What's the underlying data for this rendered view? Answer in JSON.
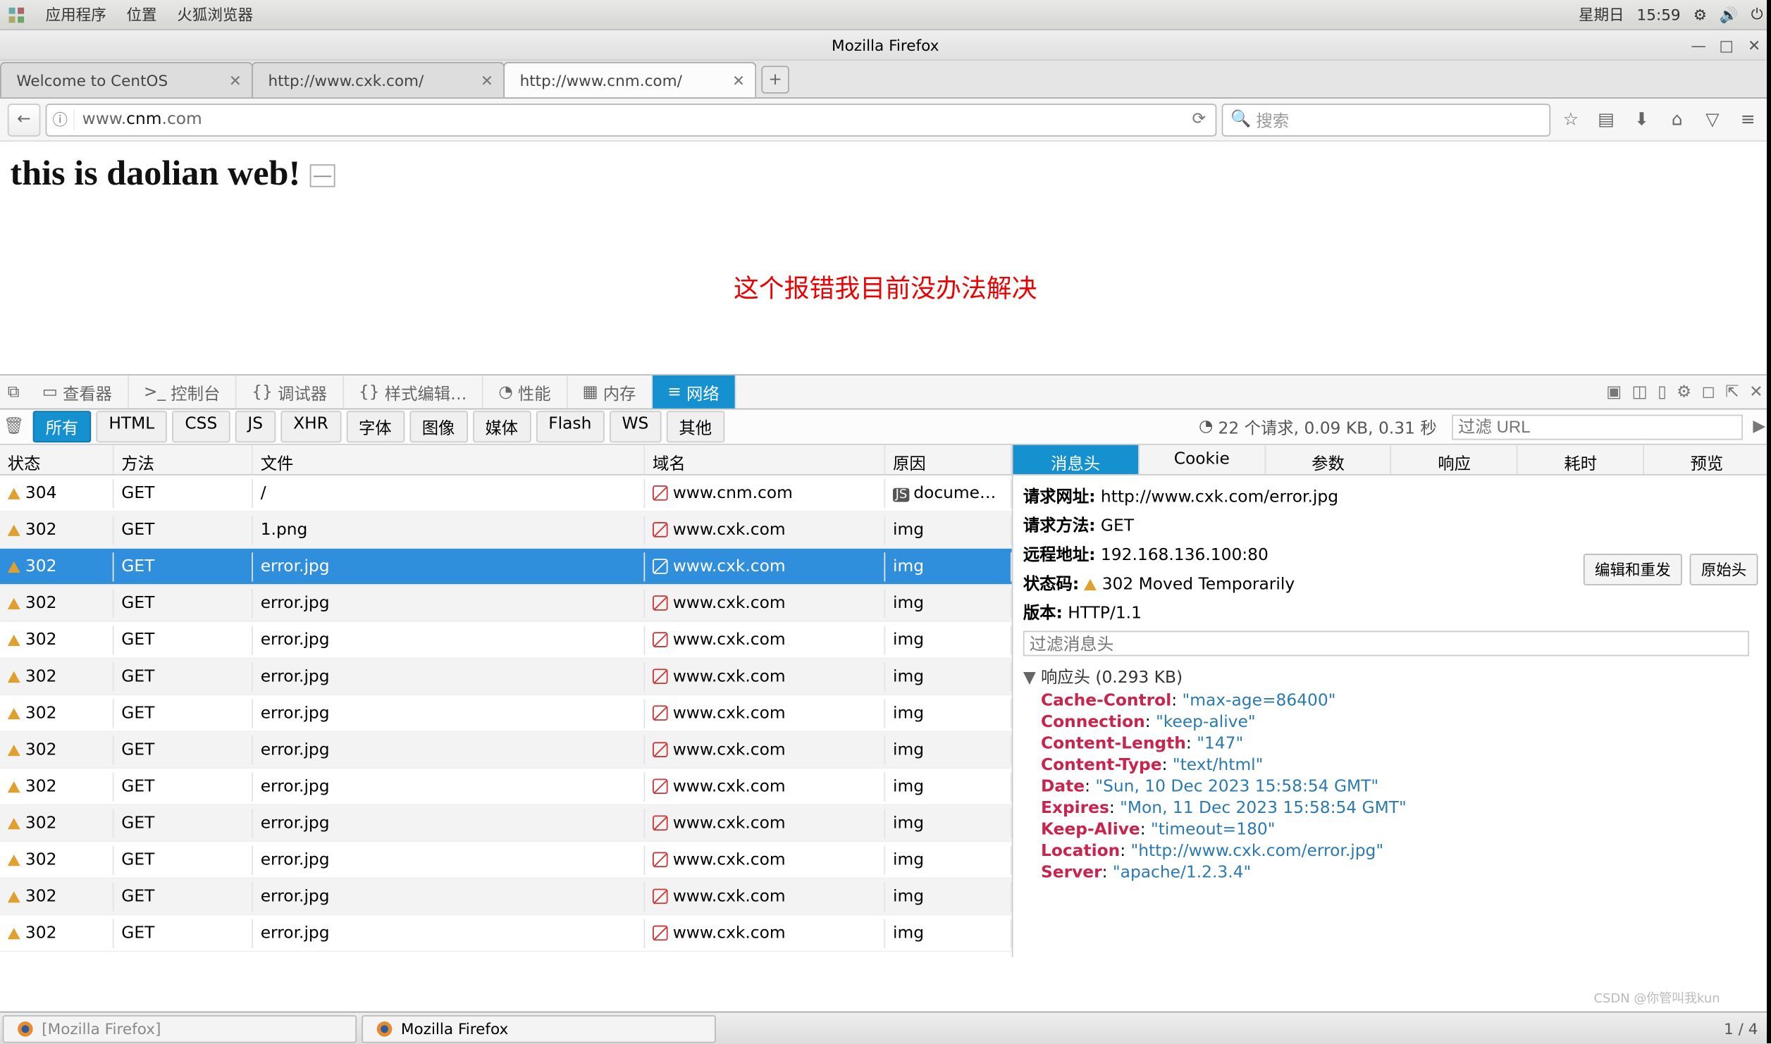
{
  "topbar": {
    "menus": [
      "应用程序",
      "位置",
      "火狐浏览器"
    ],
    "day": "星期日",
    "time": "15:59"
  },
  "window": {
    "title": "Mozilla Firefox"
  },
  "tabs": [
    {
      "label": "Welcome to CentOS",
      "active": false
    },
    {
      "label": "http://www.cxk.com/",
      "active": false
    },
    {
      "label": "http://www.cnm.com/",
      "active": true
    }
  ],
  "url": {
    "prefix": "www.",
    "host": "cnm",
    "suffix": ".com",
    "search_placeholder": "搜索"
  },
  "page": {
    "heading": "this is daolian web!",
    "red_note": "这个报错我目前没办法解决"
  },
  "devtools": {
    "panel_tabs": [
      "查看器",
      "控制台",
      "调试器",
      "样式编辑…",
      "性能",
      "内存",
      "网络"
    ],
    "active_panel": 6,
    "net_filters": [
      "所有",
      "HTML",
      "CSS",
      "JS",
      "XHR",
      "字体",
      "图像",
      "媒体",
      "Flash",
      "WS",
      "其他"
    ],
    "net_active_filter": 0,
    "summary": "22 个请求, 0.09 KB, 0.31 秒",
    "filter_url_placeholder": "过滤 URL",
    "columns": [
      "状态",
      "方法",
      "文件",
      "域名",
      "原因"
    ],
    "rows": [
      {
        "status": "304",
        "method": "GET",
        "file": "/",
        "domain": "www.cnm.com",
        "reason": "document",
        "sel": false
      },
      {
        "status": "302",
        "method": "GET",
        "file": "1.png",
        "domain": "www.cxk.com",
        "reason": "img",
        "sel": false
      },
      {
        "status": "302",
        "method": "GET",
        "file": "error.jpg",
        "domain": "www.cxk.com",
        "reason": "img",
        "sel": true
      },
      {
        "status": "302",
        "method": "GET",
        "file": "error.jpg",
        "domain": "www.cxk.com",
        "reason": "img",
        "sel": false
      },
      {
        "status": "302",
        "method": "GET",
        "file": "error.jpg",
        "domain": "www.cxk.com",
        "reason": "img",
        "sel": false
      },
      {
        "status": "302",
        "method": "GET",
        "file": "error.jpg",
        "domain": "www.cxk.com",
        "reason": "img",
        "sel": false
      },
      {
        "status": "302",
        "method": "GET",
        "file": "error.jpg",
        "domain": "www.cxk.com",
        "reason": "img",
        "sel": false
      },
      {
        "status": "302",
        "method": "GET",
        "file": "error.jpg",
        "domain": "www.cxk.com",
        "reason": "img",
        "sel": false
      },
      {
        "status": "302",
        "method": "GET",
        "file": "error.jpg",
        "domain": "www.cxk.com",
        "reason": "img",
        "sel": false
      },
      {
        "status": "302",
        "method": "GET",
        "file": "error.jpg",
        "domain": "www.cxk.com",
        "reason": "img",
        "sel": false
      },
      {
        "status": "302",
        "method": "GET",
        "file": "error.jpg",
        "domain": "www.cxk.com",
        "reason": "img",
        "sel": false
      },
      {
        "status": "302",
        "method": "GET",
        "file": "error.jpg",
        "domain": "www.cxk.com",
        "reason": "img",
        "sel": false
      },
      {
        "status": "302",
        "method": "GET",
        "file": "error.jpg",
        "domain": "www.cxk.com",
        "reason": "img",
        "sel": false
      }
    ],
    "detail_tabs": [
      "消息头",
      "Cookie",
      "参数",
      "响应",
      "耗时",
      "预览"
    ],
    "detail_active": 0,
    "detail": {
      "request_url_label": "请求网址:",
      "request_url": "http://www.cxk.com/error.jpg",
      "request_method_label": "请求方法:",
      "request_method": "GET",
      "remote_addr_label": "远程地址:",
      "remote_addr": "192.168.136.100:80",
      "status_label": "状态码:",
      "status": "302 Moved Temporarily",
      "version_label": "版本:",
      "version": "HTTP/1.1",
      "edit_resend": "编辑和重发",
      "raw": "原始头",
      "filter_headers_placeholder": "过滤消息头",
      "response_section": "响应头 (0.293 KB)",
      "response_headers": [
        {
          "k": "Cache-Control",
          "v": "\"max-age=86400\""
        },
        {
          "k": "Connection",
          "v": "\"keep-alive\""
        },
        {
          "k": "Content-Length",
          "v": "\"147\""
        },
        {
          "k": "Content-Type",
          "v": "\"text/html\""
        },
        {
          "k": "Date",
          "v": "\"Sun, 10 Dec 2023 15:58:54 GMT\""
        },
        {
          "k": "Expires",
          "v": "\"Mon, 11 Dec 2023 15:58:54 GMT\""
        },
        {
          "k": "Keep-Alive",
          "v": "\"timeout=180\""
        },
        {
          "k": "Location",
          "v": "\"http://www.cxk.com/error.jpg\""
        },
        {
          "k": "Server",
          "v": "\"apache/1.2.3.4\""
        }
      ]
    }
  },
  "taskbar": {
    "items": [
      {
        "label": "[Mozilla Firefox]",
        "inactive": true
      },
      {
        "label": "Mozilla Firefox",
        "inactive": false
      }
    ],
    "page_counter": "1 / 4",
    "watermark": "CSDN @你管叫我kun"
  }
}
